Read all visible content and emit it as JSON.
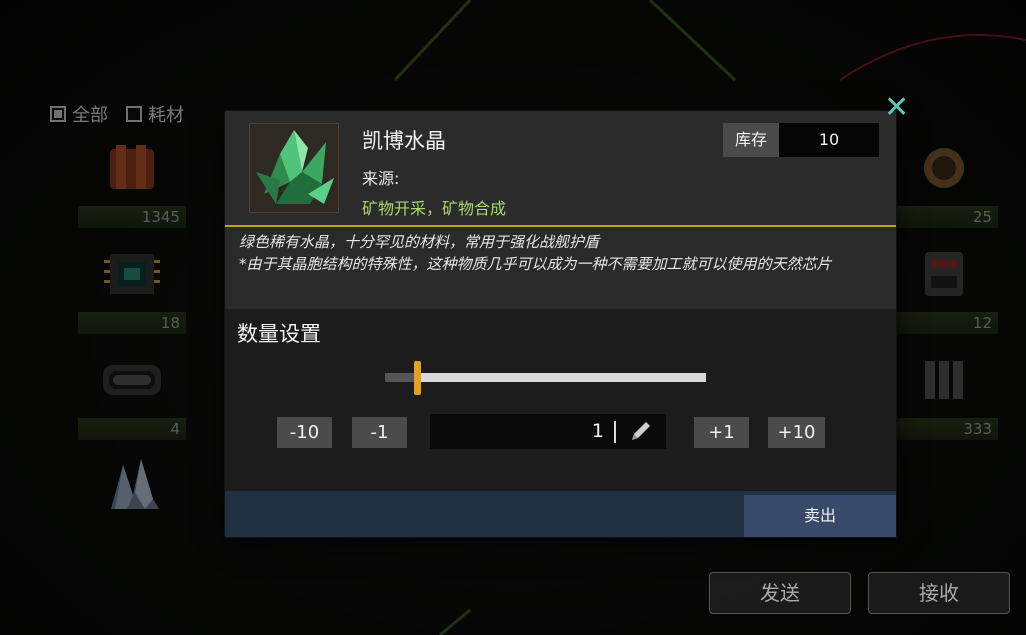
{
  "filters": [
    {
      "label": "全部",
      "checked": true
    },
    {
      "label": "耗材",
      "checked": false
    }
  ],
  "inventory": {
    "counts": [
      "1345",
      "18",
      "4",
      "25",
      "12",
      "333"
    ]
  },
  "dialog": {
    "item_name": "凯博水晶",
    "source_label": "来源:",
    "source_value": "矿物开采，矿物合成",
    "stock_label": "库存",
    "stock_value": "10",
    "description_line1": "绿色稀有水晶，十分罕见的材料，常用于强化战舰护盾",
    "description_line2": "*由于其晶胞结构的特殊性，这种物质几乎可以成为一种不需要加工就可以使用的天然芯片",
    "quantity_title": "数量设置",
    "slider_fraction": 0.1,
    "buttons": {
      "minus10": "-10",
      "minus1": "-1",
      "plus1": "+1",
      "plus10": "+10"
    },
    "quantity_value": "1",
    "sell_label": "卖出"
  },
  "bottom": {
    "send_label": "发送",
    "receive_label": "接收"
  },
  "colors": {
    "accent_gold": "#c79a2c",
    "source_green": "#a6d96a",
    "close_teal": "#5cc6b8",
    "sell_blue": "#384a6a"
  },
  "icons": {
    "close": "close-icon",
    "edit": "pencil-icon",
    "item": "green-crystal-icon"
  }
}
